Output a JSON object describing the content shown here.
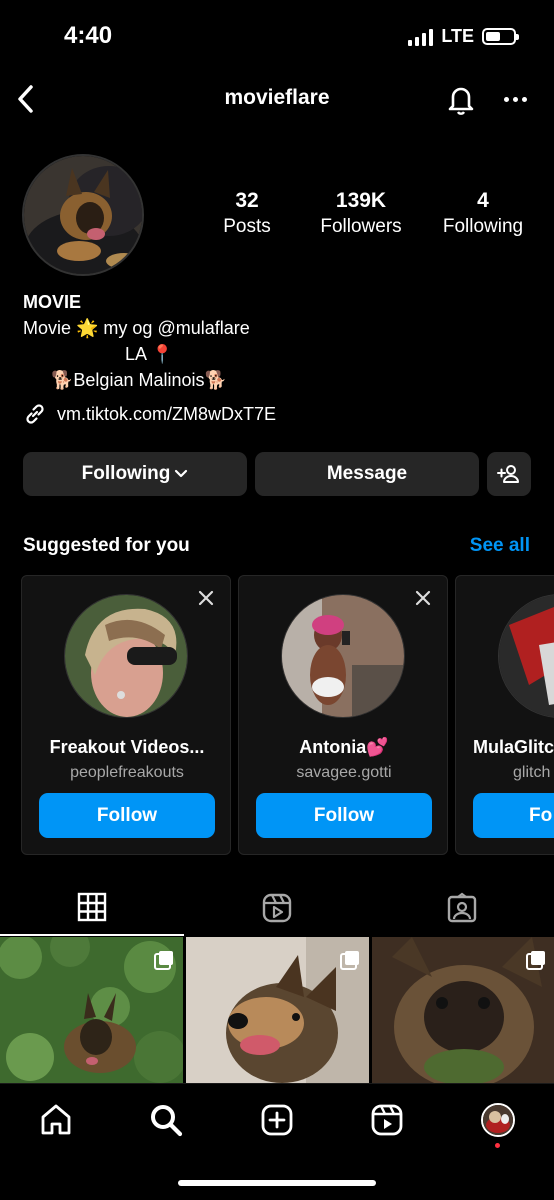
{
  "status_bar": {
    "time": "4:40",
    "network": "LTE",
    "battery_level": 0.55
  },
  "header": {
    "username": "movieflare"
  },
  "stats": [
    {
      "value": "32",
      "label": "Posts"
    },
    {
      "value": "139K",
      "label": "Followers"
    },
    {
      "value": "4",
      "label": "Following"
    }
  ],
  "bio": {
    "name": "MOVIE",
    "line1": "Movie 🌟 my og @mulaflare",
    "line2": "LA 📍",
    "line3": "🐕Belgian Malinois🐕",
    "link": "vm.tiktok.com/ZM8wDxT7E"
  },
  "actions": {
    "following_label": "Following",
    "message_label": "Message"
  },
  "suggested": {
    "title": "Suggested for you",
    "see_all": "See all",
    "cards": [
      {
        "name": "Freakout Videos...",
        "username": "peoplefreakouts",
        "button": "Follow"
      },
      {
        "name": "Antonia💕",
        "username": "savagee.gotti",
        "button": "Follow"
      },
      {
        "name": "MulaGlitc",
        "username": "glitch",
        "button": "Fo"
      }
    ]
  },
  "tabs": [
    "posts-grid",
    "reels",
    "tagged"
  ],
  "icons": {
    "back": "chevron-left-icon",
    "bell": "bell-icon",
    "more": "more-icon",
    "link": "link-icon",
    "add_user": "add-user-icon",
    "home": "home-icon",
    "search": "search-icon",
    "create": "plus-square-icon",
    "reels": "reels-icon",
    "profile": "avatar"
  },
  "colors": {
    "background": "#000000",
    "accent": "#0095f6",
    "button_gray": "#262626",
    "secondary_text": "#a8a8a8"
  }
}
